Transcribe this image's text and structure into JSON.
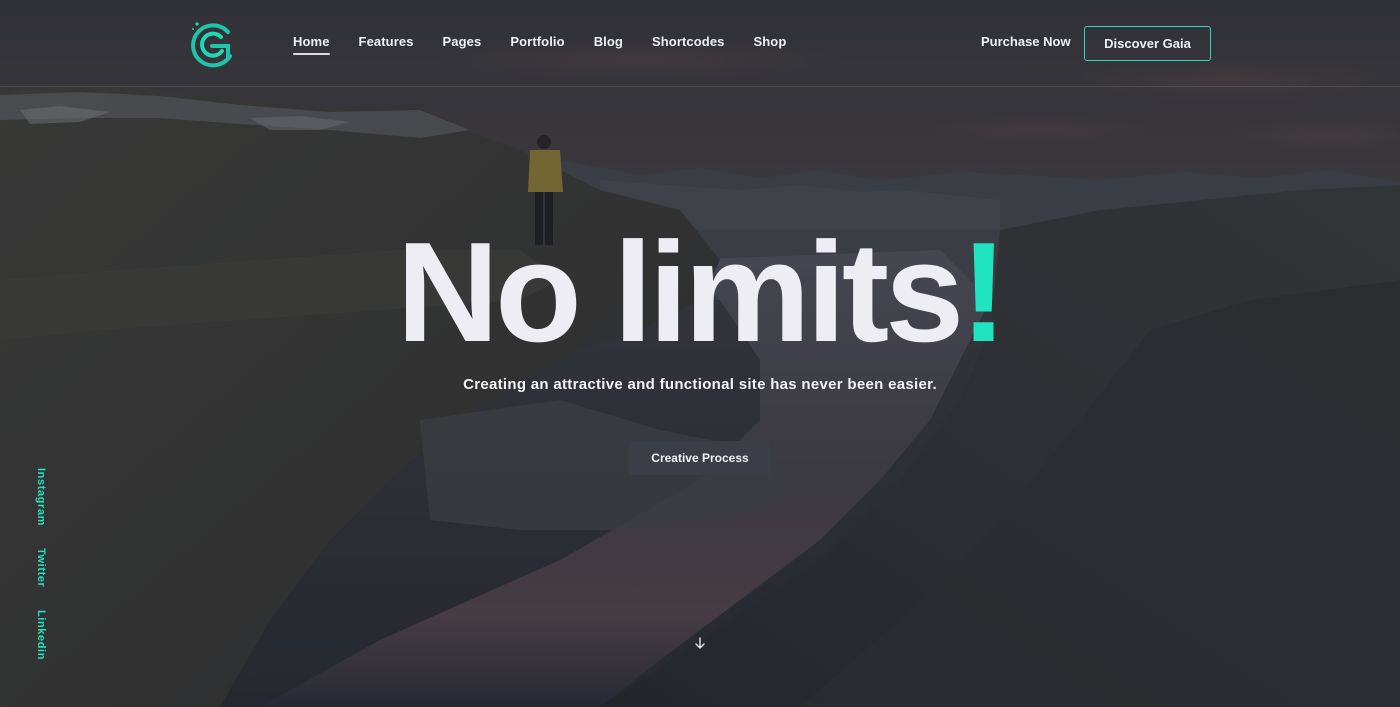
{
  "header": {
    "logo_icon": "gaia-logo-icon",
    "nav": [
      {
        "label": "Home",
        "active": true
      },
      {
        "label": "Features",
        "active": false
      },
      {
        "label": "Pages",
        "active": false
      },
      {
        "label": "Portfolio",
        "active": false
      },
      {
        "label": "Blog",
        "active": false
      },
      {
        "label": "Shortcodes",
        "active": false
      },
      {
        "label": "Shop",
        "active": false
      }
    ],
    "purchase_label": "Purchase Now",
    "discover_label": "Discover Gaia"
  },
  "hero": {
    "headline": "No limits",
    "headline_accent": "!",
    "subtitle": "Creating an attractive and functional site has never been easier.",
    "cta_label": "Creative Process",
    "scroll_icon": "arrow-down-icon"
  },
  "social": [
    {
      "label": "Instagram"
    },
    {
      "label": "Twitter"
    },
    {
      "label": "Linkedin"
    }
  ],
  "colors": {
    "accent": "#20e3bf",
    "button_border": "#2fd8b6",
    "text": "#eeedf4",
    "background": "#2b2d33"
  }
}
